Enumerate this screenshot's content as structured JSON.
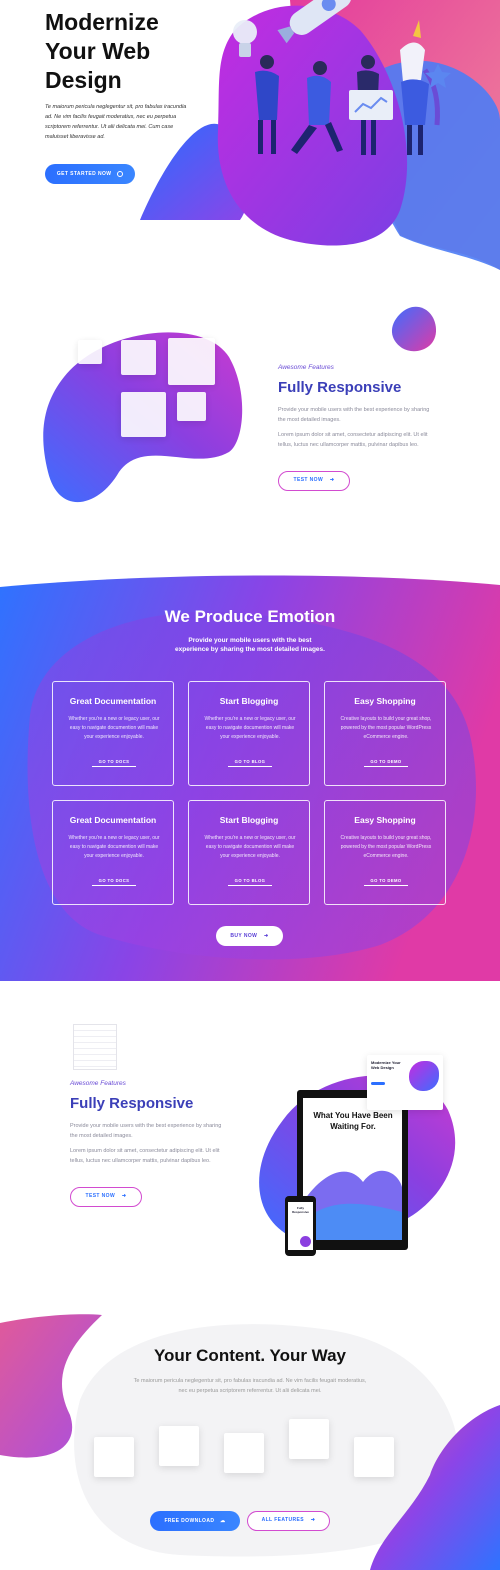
{
  "hero": {
    "title_lines": [
      "Modernize",
      "Your Web",
      "Design"
    ],
    "text": "Te maiorum pericula neglegentur sit, pro fabulas iracundia ad. Ne vim facilis feugait moderatius, nec eu perpetua scriptorem referrentur. Ut alii delicata mei. Cum case maluisset liberavisse ad.",
    "button_label": "GET STARTED NOW",
    "button_icon": "arrow-circle-icon"
  },
  "feature1": {
    "eyebrow": "Awesome Features",
    "title": "Fully Responsive",
    "text1": "Provide your mobile users with the best experience by sharing the most detailed images.",
    "text2": "Lorem ipsum dolor sit amet, consectetur adipiscing elit. Ut elit tellus, luctus nec ullamcorper mattis, pulvinar dapibus leo.",
    "button_label": "TEST NOW"
  },
  "emotion": {
    "title": "We Produce Emotion",
    "subtitle": "Provide your mobile users with the best experience by sharing the most detailed images.",
    "cards": [
      {
        "title": "Great Documentation",
        "text": "Whether you're a new or legacy user, our easy to navigate documention will make your experience enjoyable.",
        "link": "GO TO DOCS"
      },
      {
        "title": "Start Blogging",
        "text": "Whether you're a new or legacy user, our easy to navigate documention will make your experience enjoyable.",
        "link": "GO TO BLOG"
      },
      {
        "title": "Easy Shopping",
        "text": "Creative layouts to build your great shop, powered by the most popular WordPress eCommerce engine.",
        "link": "GO TO DEMO"
      },
      {
        "title": "Great Documentation",
        "text": "Whether you're a new or legacy user, our easy to navigate documention will make your experience enjoyable.",
        "link": "GO TO DOCS"
      },
      {
        "title": "Start Blogging",
        "text": "Whether you're a new or legacy user, our easy to navigate documention will make your experience enjoyable.",
        "link": "GO TO BLOG"
      },
      {
        "title": "Easy Shopping",
        "text": "Creative layouts to build your great shop, powered by the most popular WordPress eCommerce engine.",
        "link": "GO TO DEMO"
      }
    ],
    "button_label": "BUY NOW"
  },
  "feature2": {
    "eyebrow": "Awesome Features",
    "title": "Fully Responsive",
    "text1": "Provide your mobile users with the best experience by sharing the most detailed images.",
    "text2": "Lorem ipsum dolor sit amet, consectetur adipiscing elit. Ut elit tellus, luctus nec ullamcorper mattis, pulvinar dapibus leo.",
    "button_label": "TEST NOW",
    "monitor_headline": "What You Have Been Waiting For.",
    "mini_title": "Modernize Your Web Design",
    "phone_title": "Fully Responsive"
  },
  "content": {
    "title": "Your Content. Your Way",
    "text": "Te maiorum pericula neglegentur sit, pro fabulas iracundia ad. Ne vim facilis feugait moderatius, nec eu perpetua scriptorem referrentur. Ut alii delicata mei.",
    "download_label": "FREE DOWNLOAD",
    "features_label": "ALL FEATURES"
  },
  "colors": {
    "blue": "#2b6fff",
    "purple": "#7b3fe4",
    "magenta": "#e03aa6",
    "navy": "#3b3fb8"
  }
}
